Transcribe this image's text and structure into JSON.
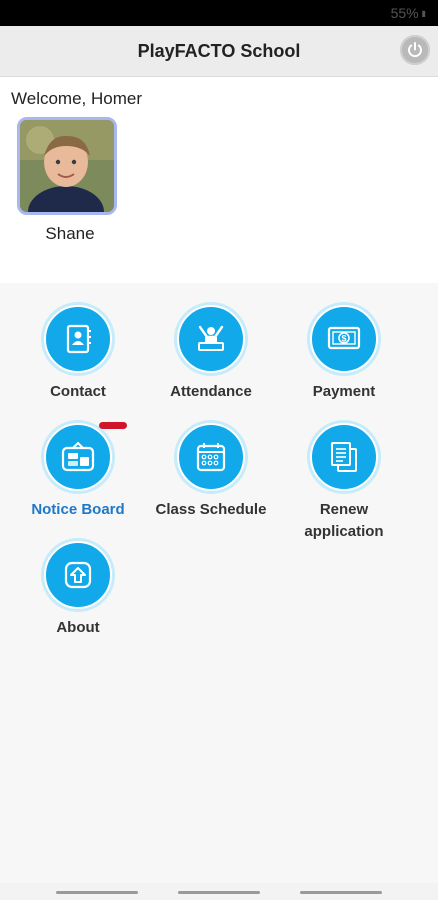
{
  "status": {
    "battery": "55%",
    "battery_icon": "battery-icon"
  },
  "header": {
    "title": "PlayFACTO School",
    "power_icon": "power-icon"
  },
  "profile": {
    "welcome": "Welcome, Homer",
    "child_name": "Shane"
  },
  "menu": {
    "items": [
      {
        "label": "Contact",
        "icon": "contact-book-icon"
      },
      {
        "label": "Attendance",
        "icon": "attendance-icon"
      },
      {
        "label": "Payment",
        "icon": "payment-icon"
      },
      {
        "label": "Notice Board",
        "icon": "notice-board-icon",
        "active": true
      },
      {
        "label": "Class Schedule",
        "icon": "calendar-icon"
      },
      {
        "label": "Renew application",
        "icon": "documents-icon"
      },
      {
        "label": "About",
        "icon": "arrow-up-icon"
      }
    ]
  },
  "colors": {
    "accent": "#12a9ea",
    "active_label": "#1e78c8",
    "badge": "#d0152a"
  }
}
